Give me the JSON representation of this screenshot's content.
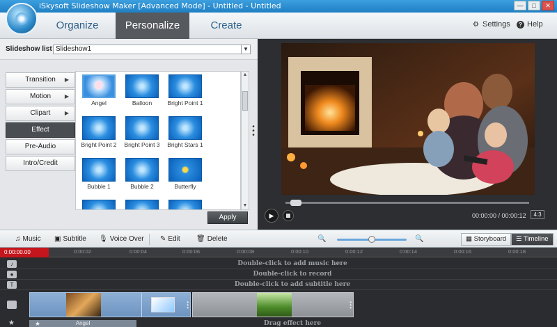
{
  "window": {
    "title": "iSkysoft Slideshow Maker [Advanced Mode] - Untitled - Untitled",
    "controls": [
      "—",
      "□",
      "✕"
    ]
  },
  "nav": {
    "tabs": [
      "Organize",
      "Personalize",
      "Create"
    ],
    "active_tab": "Personalize",
    "settings_label": "Settings",
    "help_label": "Help"
  },
  "slideshow_list": {
    "label": "Slideshow list :",
    "value": "Slideshow1"
  },
  "categories": [
    {
      "label": "Transition",
      "arrow": "▶"
    },
    {
      "label": "Motion",
      "arrow": "▶"
    },
    {
      "label": "Clipart",
      "arrow": "▶"
    },
    {
      "label": "Effect",
      "arrow": ""
    },
    {
      "label": "Pre-Audio",
      "arrow": ""
    },
    {
      "label": "Intro/Credit",
      "arrow": ""
    }
  ],
  "active_category": "Effect",
  "effects": [
    "Angel",
    "Balloon",
    "Bright Point 1",
    "Bright Point 2",
    "Bright Point 3",
    "Bright Stars 1",
    "Bubble 1",
    "Bubble 2",
    "Butterfly"
  ],
  "selected_effect": "Angel",
  "apply_label": "Apply",
  "player": {
    "time": "00:00:00 / 00:00:12",
    "aspect": "4:3",
    "progress": 0.02
  },
  "toolbar": {
    "music": "Music",
    "subtitle": "Subtitle",
    "voice_over": "Voice Over",
    "edit": "Edit",
    "delete": "Delete",
    "storyboard": "Storyboard",
    "timeline": "Timeline",
    "zoom_level": 0.5
  },
  "timeline": {
    "current_time": "0:00:00.00",
    "ticks": [
      "0:00:02",
      "0:00:04",
      "0:00:06",
      "0:00:08",
      "0:00:10",
      "0:00:12",
      "0:00:14",
      "0:00:16",
      "0:00:18"
    ],
    "music_hint": "Double-click to add music here",
    "record_hint": "Double-click to record",
    "subtitle_hint": "Double-click to add subtitle here",
    "effect_clip": "Angel",
    "effect_hint": "Drag effect here"
  }
}
